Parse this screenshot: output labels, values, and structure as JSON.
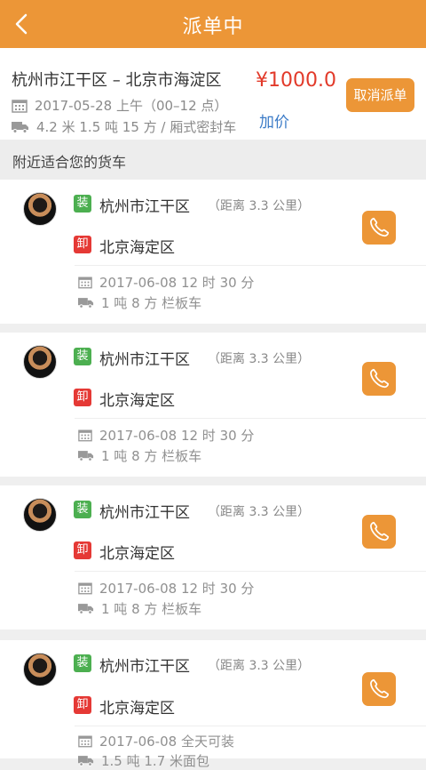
{
  "header": {
    "title": "派单中"
  },
  "order": {
    "route": "杭州市江干区 – 北京市海淀区",
    "date": "2017-05-28  上午（00–12 点）",
    "spec": "4.2 米 1.5 吨 15 方 / 厢式密封车",
    "price": "¥1000.0",
    "add_price": "加价",
    "cancel_label": "取消派单"
  },
  "section": {
    "title": "附近适合您的货车"
  },
  "labels": {
    "load": "装",
    "unload": "卸"
  },
  "trucks": [
    {
      "from": "杭州市江干区",
      "distance": "（距离 3.3 公里）",
      "to": "北京海定区",
      "date": "2017-06-08    12 时 30 分",
      "spec": "1 吨 8 方   栏板车"
    },
    {
      "from": "杭州市江干区",
      "distance": "（距离 3.3 公里）",
      "to": "北京海定区",
      "date": "2017-06-08    12 时 30 分",
      "spec": "1 吨 8 方   栏板车"
    },
    {
      "from": "杭州市江干区",
      "distance": "（距离 3.3 公里）",
      "to": "北京海定区",
      "date": "2017-06-08    12 时 30 分",
      "spec": "1 吨 8 方   栏板车"
    },
    {
      "from": "杭州市江干区",
      "distance": "（距离 3.3 公里）",
      "to": "北京海定区",
      "date": "2017-06-08    全天可装",
      "spec": "1.5 吨   1.7 米面包"
    }
  ],
  "icons": {
    "back": "chevron-left-icon",
    "calendar": "calendar-icon",
    "truck": "truck-icon",
    "phone": "phone-icon"
  },
  "colors": {
    "accent": "#ec9637",
    "price": "#e23a2a",
    "link": "#3b7bc7",
    "load_badge": "#4caf50",
    "unload_badge": "#e53935"
  }
}
